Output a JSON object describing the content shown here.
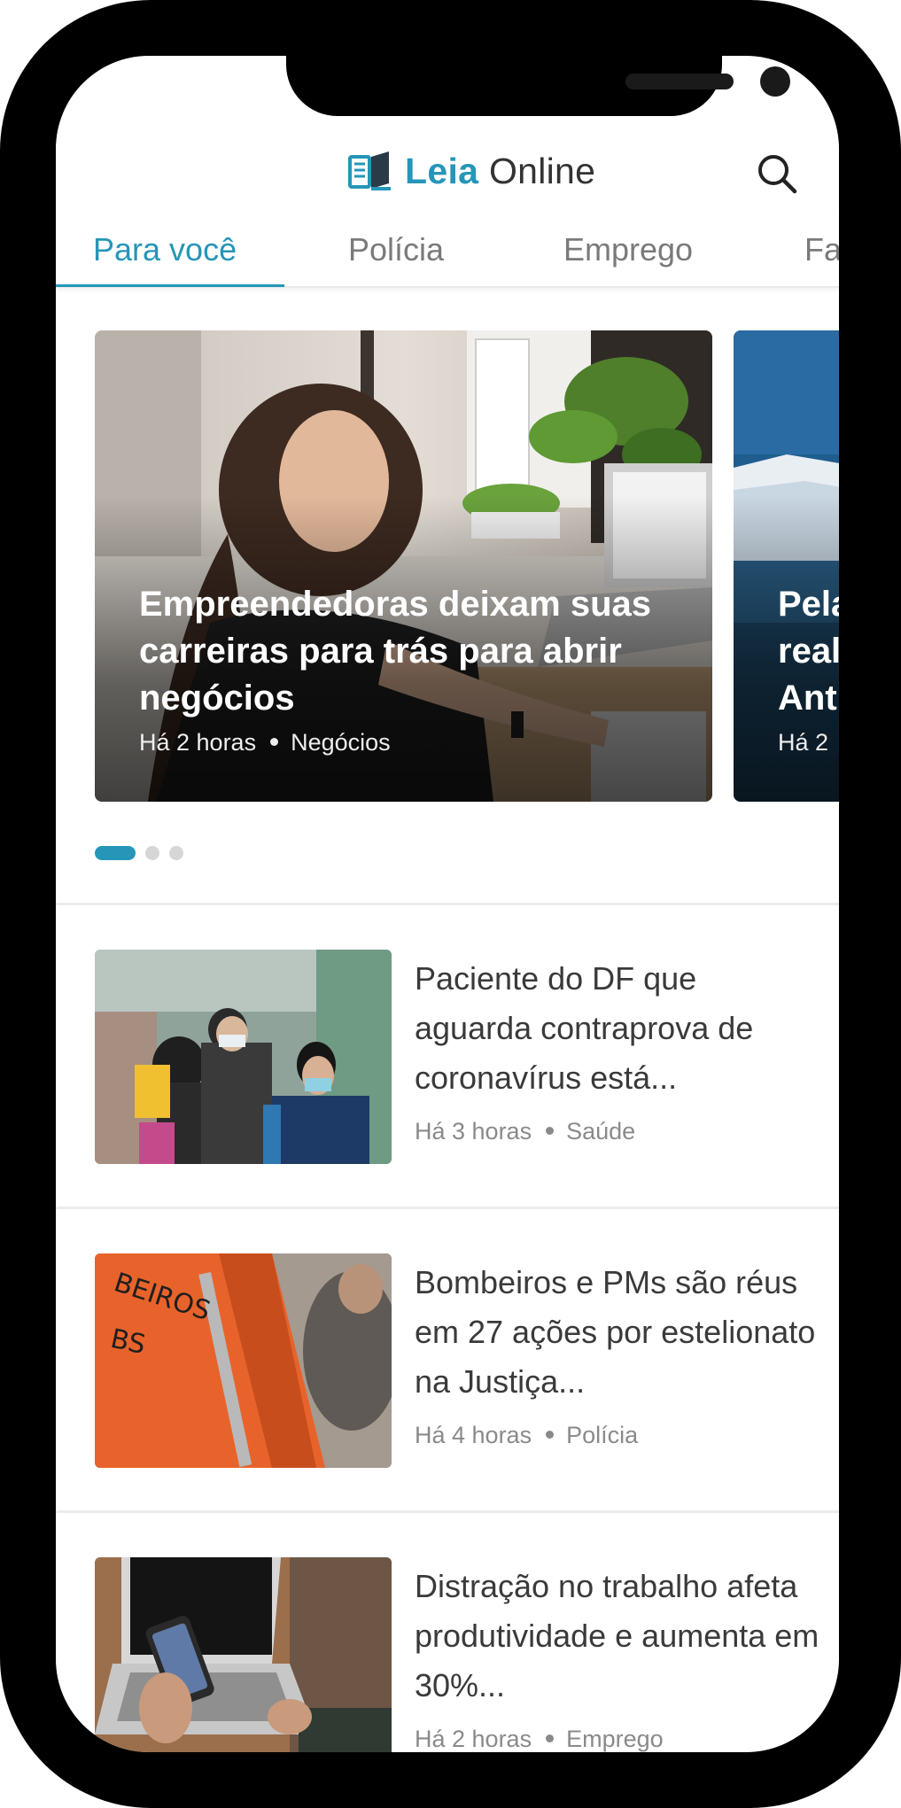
{
  "app": {
    "logo_brand": "Leia",
    "logo_rest": " Online",
    "logo_icon": "book-icon",
    "search_icon": "search-icon",
    "accent_color": "#2596b8"
  },
  "tabs": [
    {
      "label": "Para você",
      "active": true
    },
    {
      "label": "Polícia",
      "active": false
    },
    {
      "label": "Emprego",
      "active": false
    },
    {
      "label": "Fa",
      "active": false
    }
  ],
  "featured": [
    {
      "title": "Empreendedoras deixam suas carreiras para trás para abrir negócios",
      "time": "Há 2 horas",
      "category": "Negócios"
    },
    {
      "title": "Pela\nreal\nAnt",
      "time": "Há 2",
      "category": ""
    }
  ],
  "pagination": {
    "total": 3,
    "active_index": 0
  },
  "news": [
    {
      "title": "Paciente do DF que aguarda contraprova de coronavírus está...",
      "time": "Há 3 horas",
      "category": "Saúde"
    },
    {
      "title": "Bombeiros e PMs são réus em 27 ações por estelionato na Justiça...",
      "time": "Há 4 horas",
      "category": "Polícia"
    },
    {
      "title": "Distração no trabalho afeta produtividade e aumenta em 30%...",
      "time": "Há 2 horas",
      "category": "Emprego"
    }
  ]
}
